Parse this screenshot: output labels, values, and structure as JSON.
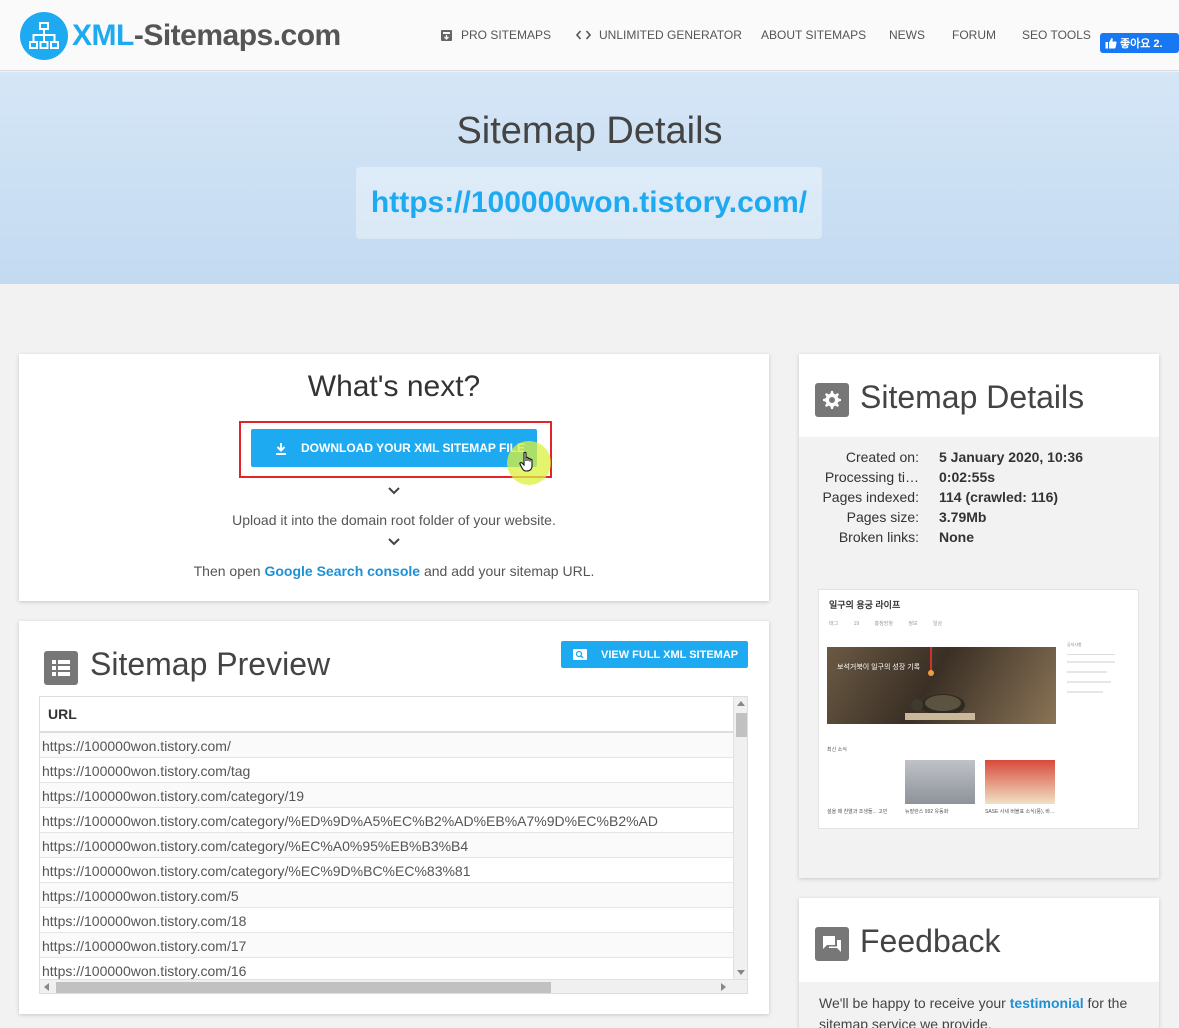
{
  "brand": {
    "logo_prefix": "XML",
    "logo_suffix": "-Sitemaps.com",
    "accent": "#1eaaf1"
  },
  "nav": {
    "items": [
      {
        "label": "PRO SITEMAPS",
        "icon": "box-icon"
      },
      {
        "label": "UNLIMITED GENERATOR",
        "icon": "code-icon"
      },
      {
        "label": "ABOUT SITEMAPS"
      },
      {
        "label": "NEWS"
      },
      {
        "label": "FORUM"
      },
      {
        "label": "SEO TOOLS"
      }
    ],
    "like_label": "좋아요 2."
  },
  "hero": {
    "title": "Sitemap Details",
    "url": "https://100000won.tistory.com/"
  },
  "whats_next": {
    "title": "What's next?",
    "download_label": "DOWNLOAD YOUR XML SITEMAP FILE",
    "step2": "Upload it into the domain root folder of your website.",
    "step3_prefix": "Then open ",
    "step3_link": "Google Search console",
    "step3_suffix": " and add your sitemap URL."
  },
  "preview": {
    "title": "Sitemap Preview",
    "view_button": "VIEW FULL XML SITEMAP",
    "column_header": "URL",
    "rows": [
      "https://100000won.tistory.com/",
      "https://100000won.tistory.com/tag",
      "https://100000won.tistory.com/category/19",
      "https://100000won.tistory.com/category/%ED%9D%A5%EC%B2%AD%EB%A7%9D%EC%B2%AD",
      "https://100000won.tistory.com/category/%EC%A0%95%EB%B3%B4",
      "https://100000won.tistory.com/category/%EC%9D%BC%EC%83%81",
      "https://100000won.tistory.com/5",
      "https://100000won.tistory.com/18",
      "https://100000won.tistory.com/17",
      "https://100000won.tistory.com/16"
    ]
  },
  "details": {
    "title": "Sitemap Details",
    "rows": [
      {
        "label": "Created on:",
        "value": "5 January 2020, 10:36"
      },
      {
        "label": "Processing ti…",
        "value": "0:02:55s"
      },
      {
        "label": "Pages indexed:",
        "value": "114 (crawled: 116)"
      },
      {
        "label": "Pages size:",
        "value": "3.79Mb"
      },
      {
        "label": "Broken links:",
        "value": "None"
      }
    ],
    "thumbnail": {
      "site_title": "일구의 용궁 라이프",
      "nav": "태그 19 흥청망청 정보 일상",
      "hero_text": "보석거북이 일구의 성장 기록",
      "section": "최신 소식",
      "side_heading": "공지사항",
      "captions": [
        "설을 때 찬열과 조생들... 고민",
        "뉴발란스 992 유동화",
        "SASE 사세 버블표 소식(풍), 바..."
      ]
    }
  },
  "feedback": {
    "title": "Feedback",
    "text_prefix": "We'll be happy to receive your ",
    "text_link": "testimonial",
    "text_suffix": " for the sitemap service we provide."
  }
}
